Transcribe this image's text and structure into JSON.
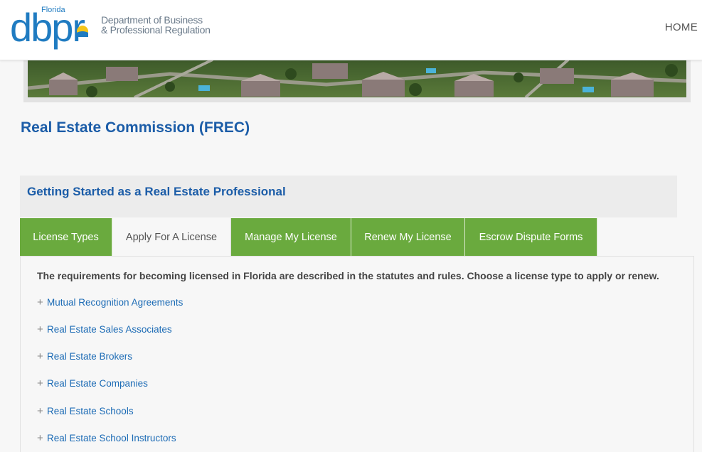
{
  "header": {
    "logo_mark": "dbpr",
    "logo_state": "Florida",
    "logo_line1": "Department of Business",
    "logo_line2": "& Professional Regulation",
    "nav_home": "HOME"
  },
  "page_title": "Real Estate Commission (FREC)",
  "section_title": "Getting Started as a Real Estate Professional",
  "tabs": [
    {
      "label": "License Types",
      "active": false
    },
    {
      "label": "Apply For A License",
      "active": true
    },
    {
      "label": "Manage My License",
      "active": false
    },
    {
      "label": "Renew My License",
      "active": false
    },
    {
      "label": "Escrow Dispute Forms",
      "active": false
    }
  ],
  "panel": {
    "intro": "The requirements for becoming licensed in Florida are described in the statutes and rules.  Choose a license type to apply or renew.",
    "items": [
      {
        "icon": "+",
        "label": "Mutual Recognition Agreements"
      },
      {
        "icon": "+",
        "label": "Real Estate Sales Associates"
      },
      {
        "icon": "+",
        "label": "Real Estate Brokers"
      },
      {
        "icon": "+",
        "label": "Real Estate Companies"
      },
      {
        "icon": "+",
        "label": "Real Estate Schools"
      },
      {
        "icon": "+",
        "label": "Real Estate School Instructors"
      }
    ]
  },
  "colors": {
    "brand_blue": "#1f7bc1",
    "heading_blue": "#1c5da8",
    "tab_green": "#6aaa3e",
    "link_blue": "#1c6bb5"
  }
}
